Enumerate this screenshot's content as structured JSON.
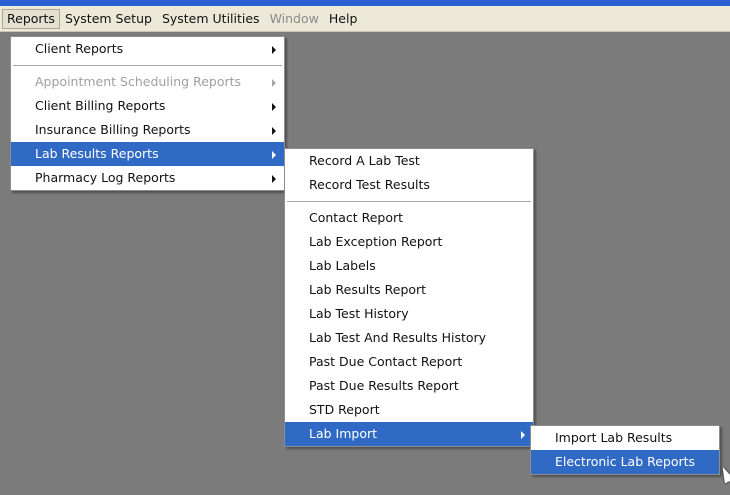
{
  "menubar": {
    "items": [
      "Reports",
      "System Setup",
      "System Utilities",
      "Window",
      "Help"
    ]
  },
  "reports_menu": {
    "items": [
      {
        "label": "Client Reports"
      },
      {
        "label": "Appointment Scheduling Reports"
      },
      {
        "label": "Client Billing Reports"
      },
      {
        "label": "Insurance Billing Reports"
      },
      {
        "label": "Lab Results Reports"
      },
      {
        "label": "Pharmacy Log Reports"
      }
    ]
  },
  "lab_results_menu": {
    "items": [
      {
        "label": "Record A Lab Test"
      },
      {
        "label": "Record Test Results"
      },
      {
        "label": "Contact Report"
      },
      {
        "label": "Lab Exception Report"
      },
      {
        "label": "Lab Labels"
      },
      {
        "label": "Lab Results Report"
      },
      {
        "label": "Lab Test History"
      },
      {
        "label": "Lab Test And Results History"
      },
      {
        "label": "Past Due Contact Report"
      },
      {
        "label": "Past Due Results Report"
      },
      {
        "label": "STD Report"
      },
      {
        "label": "Lab Import"
      }
    ]
  },
  "lab_import_menu": {
    "items": [
      {
        "label": "Import Lab Results"
      },
      {
        "label": "Electronic Lab Reports"
      }
    ]
  },
  "colors": {
    "highlight": "#316ac5",
    "menubar_bg": "#ece9d8",
    "desktop_bg": "#7b7b7b"
  }
}
